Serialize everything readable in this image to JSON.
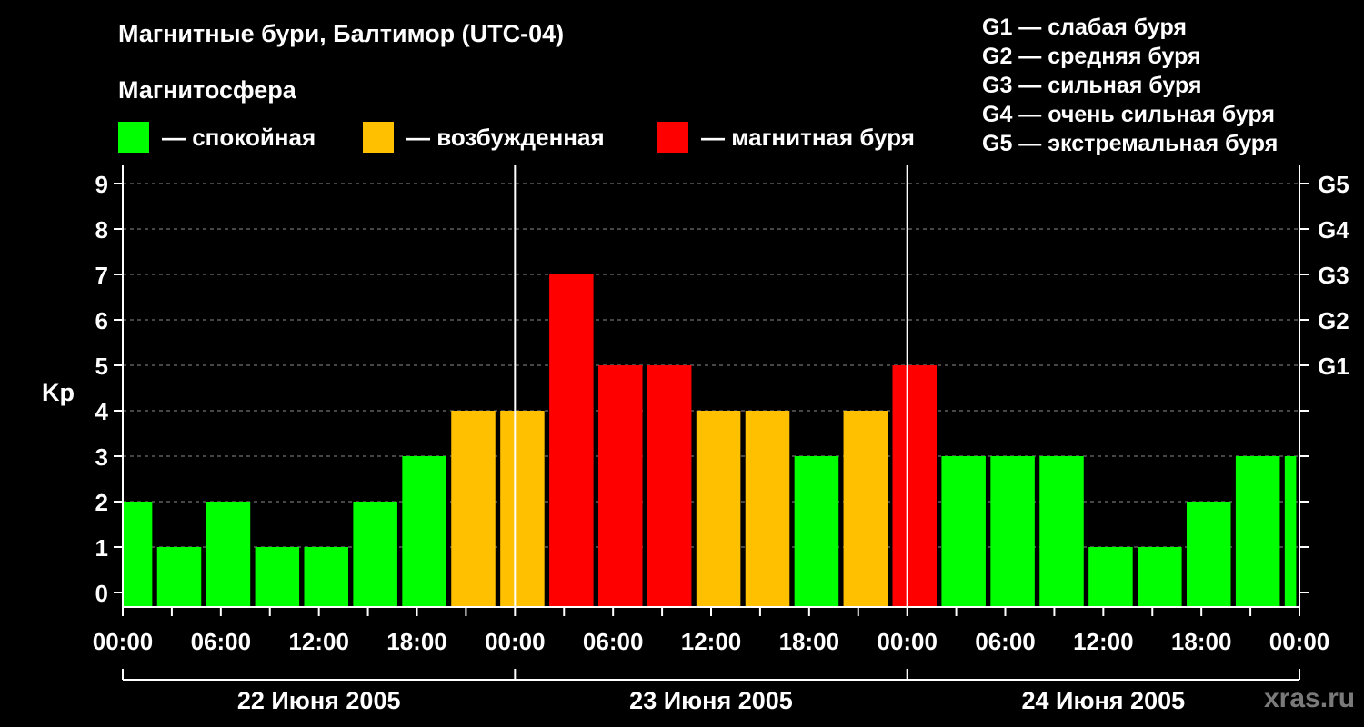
{
  "title": "Магнитные бури, Балтимор (UTC-04)",
  "subtitle": "Магнитосфера",
  "legend": [
    {
      "label": "— спокойная",
      "color": "#00ff00"
    },
    {
      "label": "— возбужденная",
      "color": "#ffc000"
    },
    {
      "label": "— магнитная буря",
      "color": "#ff0000"
    }
  ],
  "g_scale": [
    "G1 — слабая буря",
    "G2 — средняя буря",
    "G3 — сильная буря",
    "G4 — очень сильная буря",
    "G5 — экстремальная буря"
  ],
  "watermark": "xras.ru",
  "chart_data": {
    "type": "bar",
    "ylabel": "Kp",
    "ylim": [
      0,
      9
    ],
    "yticks": [
      0,
      1,
      2,
      3,
      4,
      5,
      6,
      7,
      8,
      9
    ],
    "right_axis_labels": [
      {
        "kp": 5,
        "label": "G1"
      },
      {
        "kp": 6,
        "label": "G2"
      },
      {
        "kp": 7,
        "label": "G3"
      },
      {
        "kp": 8,
        "label": "G4"
      },
      {
        "kp": 9,
        "label": "G5"
      }
    ],
    "grid": true,
    "x_range_hours": [
      0,
      72
    ],
    "xtick_labels": [
      "00:00",
      "06:00",
      "12:00",
      "18:00",
      "00:00",
      "06:00",
      "12:00",
      "18:00",
      "00:00",
      "06:00",
      "12:00",
      "18:00",
      "00:00"
    ],
    "xtick_hours": [
      0,
      6,
      12,
      18,
      24,
      30,
      36,
      42,
      48,
      54,
      60,
      66,
      72
    ],
    "day_boundaries_hours": [
      24,
      48
    ],
    "days": [
      {
        "label": "22 Июня 2005",
        "start": 0,
        "end": 24
      },
      {
        "label": "23 Июня 2005",
        "start": 24,
        "end": 48
      },
      {
        "label": "24 Июня 2005",
        "start": 48,
        "end": 72
      }
    ],
    "color_thresholds": {
      "quiet_max": 3,
      "active_max": 4
    },
    "bars": [
      {
        "start": 0,
        "end": 1.8,
        "kp": 2
      },
      {
        "start": 2.1,
        "end": 4.8,
        "kp": 1
      },
      {
        "start": 5.1,
        "end": 7.8,
        "kp": 2
      },
      {
        "start": 8.1,
        "end": 10.8,
        "kp": 1
      },
      {
        "start": 11.1,
        "end": 13.8,
        "kp": 1
      },
      {
        "start": 14.1,
        "end": 16.8,
        "kp": 2
      },
      {
        "start": 17.1,
        "end": 19.8,
        "kp": 3
      },
      {
        "start": 20.1,
        "end": 22.8,
        "kp": 4
      },
      {
        "start": 23.1,
        "end": 25.8,
        "kp": 4
      },
      {
        "start": 26.1,
        "end": 28.8,
        "kp": 7
      },
      {
        "start": 29.1,
        "end": 31.8,
        "kp": 5
      },
      {
        "start": 32.1,
        "end": 34.8,
        "kp": 5
      },
      {
        "start": 35.1,
        "end": 37.8,
        "kp": 4
      },
      {
        "start": 38.1,
        "end": 40.8,
        "kp": 4
      },
      {
        "start": 41.1,
        "end": 43.8,
        "kp": 3
      },
      {
        "start": 44.1,
        "end": 46.8,
        "kp": 4
      },
      {
        "start": 47.1,
        "end": 49.8,
        "kp": 5
      },
      {
        "start": 50.1,
        "end": 52.8,
        "kp": 3
      },
      {
        "start": 53.1,
        "end": 55.8,
        "kp": 3
      },
      {
        "start": 56.1,
        "end": 58.8,
        "kp": 3
      },
      {
        "start": 59.1,
        "end": 61.8,
        "kp": 1
      },
      {
        "start": 62.1,
        "end": 64.8,
        "kp": 1
      },
      {
        "start": 65.1,
        "end": 67.8,
        "kp": 2
      },
      {
        "start": 68.1,
        "end": 70.8,
        "kp": 3
      },
      {
        "start": 71.1,
        "end": 71.8,
        "kp": 3
      }
    ]
  }
}
